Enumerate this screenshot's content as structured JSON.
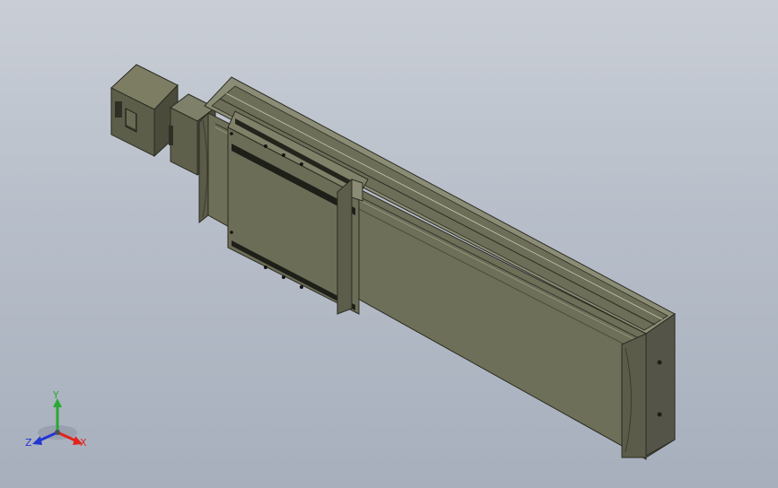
{
  "viewport": {
    "background_top": "#c9ced6",
    "background_bottom": "#a7afbd",
    "model_color": "#6e6f58",
    "model_dark": "#4a4b3c",
    "model_light": "#8a8b70"
  },
  "triad": {
    "x_label": "X",
    "y_label": "Y",
    "z_label": "Z",
    "x_color": "#e2231a",
    "y_color": "#2aa833",
    "z_color": "#2435d4"
  }
}
